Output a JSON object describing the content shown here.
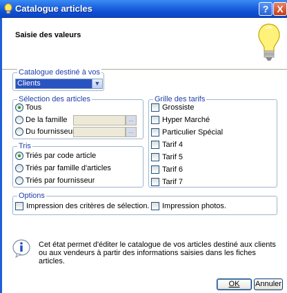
{
  "window": {
    "title": "Catalogue articles",
    "help_label": "?",
    "close_label": "X"
  },
  "header": {
    "title": "Saisie des valeurs"
  },
  "catalogue": {
    "legend": "Catalogue destiné à vos",
    "selected": "Clients"
  },
  "selection": {
    "legend": "Sélection des articles",
    "options": [
      {
        "label": "Tous",
        "checked": true
      },
      {
        "label": "De la famille",
        "checked": false
      },
      {
        "label": "Du fournisseur",
        "checked": false
      }
    ],
    "famille_value": "",
    "fournisseur_value": ""
  },
  "tris": {
    "legend": "Tris",
    "options": [
      {
        "label": "Triés par code article",
        "checked": true
      },
      {
        "label": "Triés par famille d'articles",
        "checked": false
      },
      {
        "label": "Triés par fournisseur",
        "checked": false
      }
    ]
  },
  "grille": {
    "legend": "Grille des tarifs",
    "items": [
      {
        "label": "Grossiste",
        "checked": false
      },
      {
        "label": "Hyper Marché",
        "checked": false
      },
      {
        "label": "Particulier Spécial",
        "checked": false
      },
      {
        "label": "Tarif 4",
        "checked": false
      },
      {
        "label": "Tarif 5",
        "checked": false
      },
      {
        "label": "Tarif 6",
        "checked": false
      },
      {
        "label": "Tarif 7",
        "checked": false
      }
    ]
  },
  "options": {
    "legend": "Options",
    "criteres": "Impression des critères de sélection.",
    "photos": "Impression photos."
  },
  "info": {
    "text": "Cet état permet d'éditer le catalogue de vos articles destiné aux clients ou aux vendeurs à partir des informations saisies dans les fiches articles."
  },
  "buttons": {
    "ok": "OK",
    "cancel": "Annuler"
  }
}
